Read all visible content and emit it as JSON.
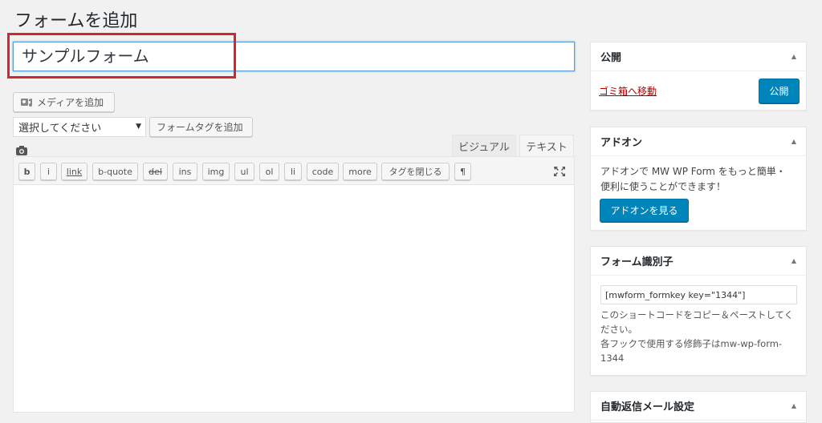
{
  "page": {
    "title": "フォームを追加"
  },
  "title_field": {
    "value": "サンプルフォーム"
  },
  "toolbar": {
    "add_media": "メディアを追加",
    "select_placeholder": "選択してください",
    "add_form_tag": "フォームタグを追加"
  },
  "editor": {
    "tabs": {
      "visual": "ビジュアル",
      "text": "テキスト"
    },
    "quicktags": [
      "b",
      "i",
      "link",
      "b-quote",
      "del",
      "ins",
      "img",
      "ul",
      "ol",
      "li",
      "code",
      "more",
      "タグを閉じる",
      "¶"
    ]
  },
  "publish_box": {
    "title": "公開",
    "trash_label": "ゴミ箱へ移動",
    "publish_label": "公開"
  },
  "addon_box": {
    "title": "アドオン",
    "description_line1": "アドオンで MW WP Form をもっと簡単・",
    "description_line2": "便利に使うことができます！",
    "button_label": "アドオンを見る"
  },
  "form_key_box": {
    "title": "フォーム識別子",
    "shortcode": "[mwform_formkey key=\"1344\"]",
    "desc_line1": "このショートコードをコピー＆ペーストしてく",
    "desc_line2": "ださい。",
    "desc_line3": "各フックで使用する修飾子はmw-wp-form-",
    "desc_line4": "1344"
  },
  "auto_reply_box": {
    "title": "自動返信メール設定"
  },
  "colors": {
    "primary": "#0085ba",
    "highlight": "#d0282e",
    "trash": "#aa0000"
  },
  "icons": [
    "media-icon",
    "camera-icon",
    "expand-icon",
    "collapse-arrow-icon"
  ]
}
